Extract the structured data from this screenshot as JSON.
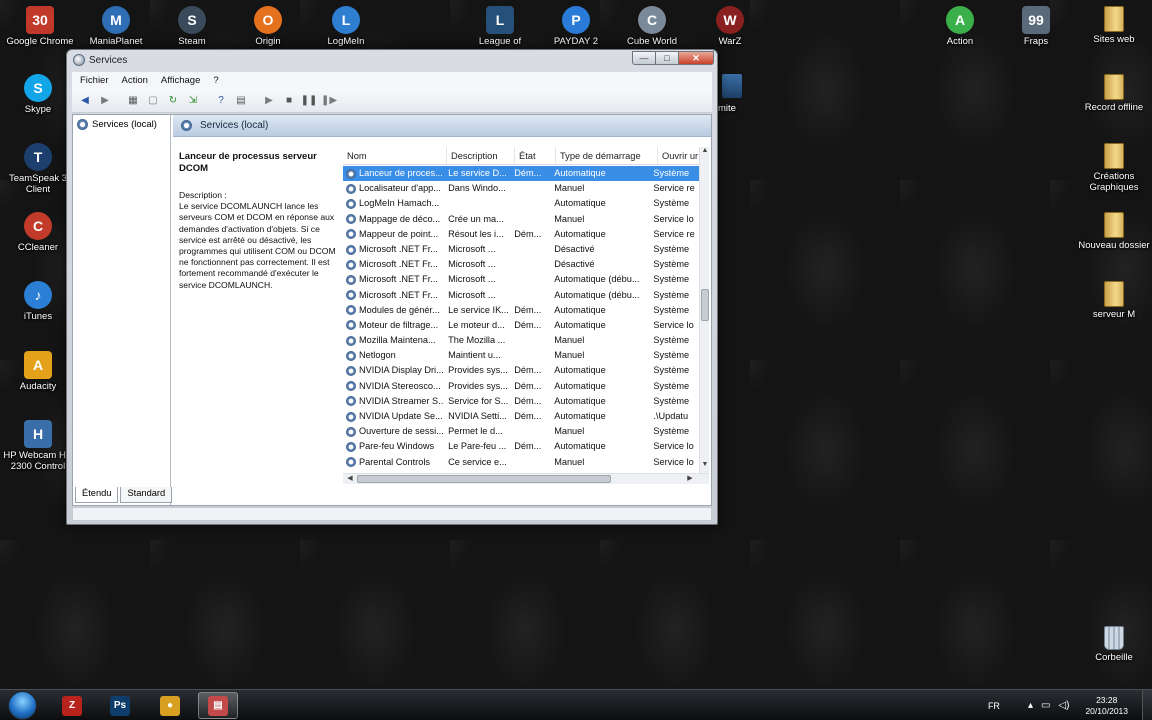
{
  "desktop": {
    "top_icons": [
      {
        "label": "Google Chrome",
        "glyph": "30",
        "color": "#c0392b"
      },
      {
        "label": "ManiaPlanet",
        "glyph": "M",
        "color": "#2f6db5"
      },
      {
        "label": "Steam",
        "glyph": "S",
        "color": "#3a4a5a"
      },
      {
        "label": "Origin",
        "glyph": "O",
        "color": "#e5701d"
      },
      {
        "label": "LogMeIn",
        "glyph": "L",
        "color": "#2f7fd0"
      },
      {
        "label": "League of",
        "glyph": "L",
        "color": "#24507a"
      },
      {
        "label": "PAYDAY 2",
        "glyph": "P",
        "color": "#2a7ad8"
      },
      {
        "label": "Cube World",
        "glyph": "C",
        "color": "#7a8a9a"
      },
      {
        "label": "WarZ",
        "glyph": "W",
        "color": "#8a1f1f"
      },
      {
        "label": "Action",
        "glyph": "A",
        "color": "#3bb04a"
      },
      {
        "label": "Fraps",
        "glyph": "99",
        "color": "#5a6a7a"
      },
      {
        "label": "Sites web",
        "glyph": "",
        "color": "#d6b25a"
      }
    ],
    "left_icons": [
      {
        "label": "Skype",
        "glyph": "S",
        "color": "#12a5e8"
      },
      {
        "label": "TeamSpeak 3 Client",
        "glyph": "T",
        "color": "#1d3f6e"
      },
      {
        "label": "CCleaner",
        "glyph": "C",
        "color": "#c23b2a"
      },
      {
        "label": "iTunes",
        "glyph": "♪",
        "color": "#2b7fd4"
      },
      {
        "label": "Audacity",
        "glyph": "A",
        "color": "#e3a21a"
      },
      {
        "label": "HP Webcam HD 2300 Control",
        "glyph": "H",
        "color": "#3a6ea8"
      }
    ],
    "right_folders": [
      {
        "label": "Record offline"
      },
      {
        "label": "Créations Graphiques"
      },
      {
        "label": "Nouveau dossier"
      },
      {
        "label": "serveur M"
      }
    ],
    "recycle_bin": "Corbeille",
    "partial_label": "mite"
  },
  "window": {
    "title": "Services",
    "controls": {
      "minimize": "—",
      "maximize": "□",
      "close": "✕"
    },
    "menu": [
      "Fichier",
      "Action",
      "Affichage",
      "?"
    ],
    "toolbar_icons": [
      "back-icon",
      "forward-icon",
      "console-icon",
      "properties-icon",
      "refresh-icon",
      "export-icon",
      "help-icon",
      "view-icon",
      "play-icon",
      "stop-icon",
      "pause-icon",
      "restart-icon"
    ],
    "tree_root": "Services (local)",
    "pane_title": "Services (local)",
    "selected_service": {
      "name": "Lanceur de processus serveur DCOM",
      "description_label": "Description :",
      "description": "Le service DCOMLAUNCH lance les serveurs COM et DCOM en réponse aux demandes d'activation d'objets. Si ce service est arrêté ou désactivé, les programmes qui utilisent COM ou DCOM ne fonctionnent pas correctement. Il est fortement recommandé d'exécuter le service DCOMLAUNCH."
    },
    "columns": [
      "Nom",
      "Description",
      "État",
      "Type de démarrage",
      "Ouvrir ur"
    ],
    "rows": [
      {
        "name": "Lanceur de proces...",
        "description": "Le service D...",
        "state": "Dém...",
        "startup": "Automatique",
        "logon": "Système",
        "selected": true
      },
      {
        "name": "Localisateur d'app...",
        "description": "Dans Windo...",
        "state": "",
        "startup": "Manuel",
        "logon": "Service re"
      },
      {
        "name": "LogMeIn Hamach...",
        "description": "",
        "state": "",
        "startup": "Automatique",
        "logon": "Système"
      },
      {
        "name": "Mappage de déco...",
        "description": "Crée un ma...",
        "state": "",
        "startup": "Manuel",
        "logon": "Service lo"
      },
      {
        "name": "Mappeur de point...",
        "description": "Résout les i...",
        "state": "Dém...",
        "startup": "Automatique",
        "logon": "Service re"
      },
      {
        "name": "Microsoft .NET Fr...",
        "description": "Microsoft ...",
        "state": "",
        "startup": "Désactivé",
        "logon": "Système"
      },
      {
        "name": "Microsoft .NET Fr...",
        "description": "Microsoft ...",
        "state": "",
        "startup": "Désactivé",
        "logon": "Système"
      },
      {
        "name": "Microsoft .NET Fr...",
        "description": "Microsoft ...",
        "state": "",
        "startup": "Automatique (débu...",
        "logon": "Système"
      },
      {
        "name": "Microsoft .NET Fr...",
        "description": "Microsoft ...",
        "state": "",
        "startup": "Automatique (débu...",
        "logon": "Système"
      },
      {
        "name": "Modules de génér...",
        "description": "Le service IK...",
        "state": "Dém...",
        "startup": "Automatique",
        "logon": "Système"
      },
      {
        "name": "Moteur de filtrage...",
        "description": "Le moteur d...",
        "state": "Dém...",
        "startup": "Automatique",
        "logon": "Service lo"
      },
      {
        "name": "Mozilla Maintena...",
        "description": "The Mozilla ...",
        "state": "",
        "startup": "Manuel",
        "logon": "Système"
      },
      {
        "name": "Netlogon",
        "description": "Maintient u...",
        "state": "",
        "startup": "Manuel",
        "logon": "Système"
      },
      {
        "name": "NVIDIA Display Dri...",
        "description": "Provides sys...",
        "state": "Dém...",
        "startup": "Automatique",
        "logon": "Système"
      },
      {
        "name": "NVIDIA Stereosco...",
        "description": "Provides sys...",
        "state": "Dém...",
        "startup": "Automatique",
        "logon": "Système"
      },
      {
        "name": "NVIDIA Streamer S...",
        "description": "Service for S...",
        "state": "Dém...",
        "startup": "Automatique",
        "logon": "Système"
      },
      {
        "name": "NVIDIA Update Se...",
        "description": "NVIDIA Setti...",
        "state": "Dém...",
        "startup": "Automatique",
        "logon": ".\\Updatu"
      },
      {
        "name": "Ouverture de sessi...",
        "description": "Permet le d...",
        "state": "",
        "startup": "Manuel",
        "logon": "Système"
      },
      {
        "name": "Pare-feu Windows",
        "description": "Le Pare-feu ...",
        "state": "Dém...",
        "startup": "Automatique",
        "logon": "Service lo"
      },
      {
        "name": "Parental Controls",
        "description": "Ce service e...",
        "state": "",
        "startup": "Manuel",
        "logon": "Service lo"
      }
    ],
    "tabs": [
      "Étendu",
      "Standard"
    ],
    "active_tab": "Étendu"
  },
  "taskbar": {
    "apps": [
      {
        "icon": "filezilla-icon",
        "glyph": "Z",
        "color": "#b8231e"
      },
      {
        "icon": "photoshop-icon",
        "glyph": "Ps",
        "color": "#0e3d6b"
      },
      {
        "icon": "chrome-icon",
        "glyph": "●",
        "color": "#d8a020"
      },
      {
        "icon": "services-icon",
        "glyph": "▤",
        "color": "#c24a4a"
      }
    ],
    "language": "FR",
    "time": "23:28",
    "date": "20/10/2013"
  }
}
